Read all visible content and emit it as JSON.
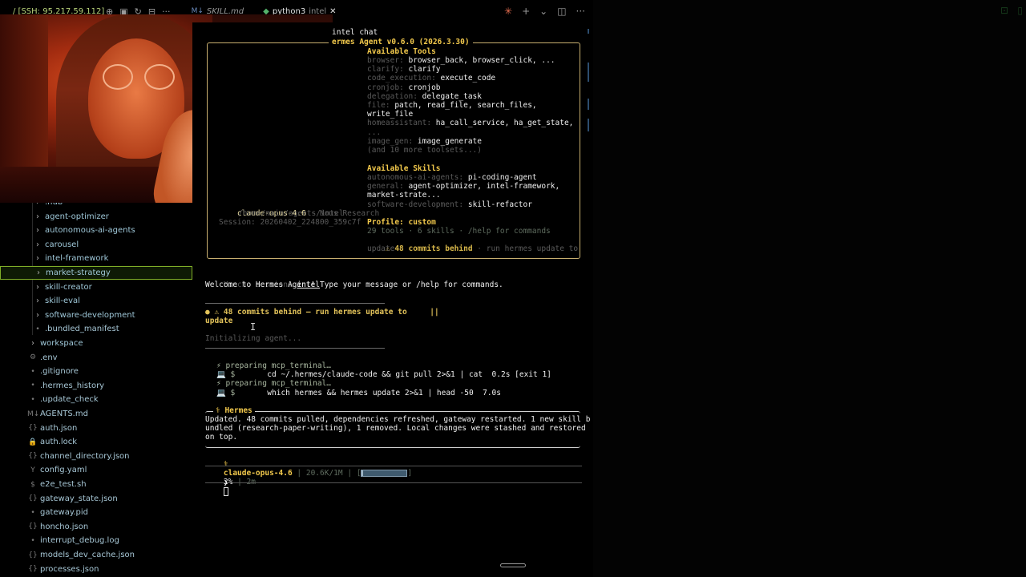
{
  "topbar": {
    "ssh_label": "/ [SSH: 95.217.59.112]",
    "tabs": [
      {
        "icon": "M↓",
        "label": "SKILL.md",
        "active": false
      },
      {
        "icon": "python-icon",
        "label": "python3",
        "sublabel": "intel",
        "active": true
      }
    ],
    "close_symbol": "✕",
    "more_symbol": "···"
  },
  "sidebar": {
    "items": [
      {
        "label": ".hub",
        "type": "folder",
        "indent": 1
      },
      {
        "label": "agent-optimizer",
        "type": "folder",
        "indent": 1
      },
      {
        "label": "autonomous-ai-agents",
        "type": "folder",
        "indent": 1
      },
      {
        "label": "carousel",
        "type": "folder",
        "indent": 1
      },
      {
        "label": "intel-framework",
        "type": "folder",
        "indent": 1
      },
      {
        "label": "market-strategy",
        "type": "folder",
        "indent": 1,
        "selected": true
      },
      {
        "label": "skill-creator",
        "type": "folder",
        "indent": 1
      },
      {
        "label": "skill-eval",
        "type": "folder",
        "indent": 1
      },
      {
        "label": "software-development",
        "type": "folder",
        "indent": 1
      },
      {
        "label": ".bundled_manifest",
        "type": "file",
        "indent": 1
      },
      {
        "label": "workspace",
        "type": "folder",
        "indent": 0
      },
      {
        "label": ".env",
        "type": "file",
        "indent": 0
      },
      {
        "label": ".gitignore",
        "type": "file",
        "indent": 0
      },
      {
        "label": ".hermes_history",
        "type": "file",
        "indent": 0
      },
      {
        "label": ".update_check",
        "type": "file",
        "indent": 0
      },
      {
        "label": "AGENTS.md",
        "type": "file",
        "indent": 0
      },
      {
        "label": "auth.json",
        "type": "file",
        "indent": 0
      },
      {
        "label": "auth.lock",
        "type": "file",
        "indent": 0
      },
      {
        "label": "channel_directory.json",
        "type": "file",
        "indent": 0
      },
      {
        "label": "config.yaml",
        "type": "file",
        "indent": 0
      },
      {
        "label": "e2e_test.sh",
        "type": "file",
        "indent": 0
      },
      {
        "label": "gateway_state.json",
        "type": "file",
        "indent": 0
      },
      {
        "label": "gateway.pid",
        "type": "file",
        "indent": 0
      },
      {
        "label": "honcho.json",
        "type": "file",
        "indent": 0
      },
      {
        "label": "interrupt_debug.log",
        "type": "file",
        "indent": 0
      },
      {
        "label": "models_dev_cache.json",
        "type": "file",
        "indent": 0
      },
      {
        "label": "processes.json",
        "type": "file",
        "indent": 0
      }
    ]
  },
  "terminal": {
    "chat_cmd": "intel chat",
    "banner_title": "ermes Agent v0.6.0 (2026.3.30)",
    "tools_heading": "Available Tools",
    "tools": [
      {
        "k": "browser: ",
        "v": "browser_back, browser_click, ..."
      },
      {
        "k": "clarify: ",
        "v": "clarify"
      },
      {
        "k": "code_execution: ",
        "v": "execute_code"
      },
      {
        "k": "cronjob: ",
        "v": "cronjob"
      },
      {
        "k": "delegation: ",
        "v": "delegate_task"
      },
      {
        "k": "file: ",
        "v": "patch, read_file, search_files,"
      },
      {
        "k": "",
        "v": "write_file"
      },
      {
        "k": "homeassistant: ",
        "v": "ha_call_service, ha_get_state,"
      },
      {
        "k": "...",
        "v": ""
      },
      {
        "k": "image_gen: ",
        "v": "image_generate"
      },
      {
        "k": "(and 10 more toolsets...)",
        "v": ""
      }
    ],
    "skills_heading": "Available Skills",
    "skills": [
      {
        "k": "autonomous-ai-agents: ",
        "v": "pi-coding-agent"
      },
      {
        "k": "general: ",
        "v": "agent-optimizer, intel-framework,"
      },
      {
        "k": "",
        "v": "market-strate..."
      },
      {
        "k": "software-development: ",
        "v": "skill-refactor"
      }
    ],
    "model": "claude-opus-4.6",
    "provider": " · Nous Research",
    "cwd": "/home/main/agents/intel",
    "session": "Session: 20260402_224800_359c7f",
    "profile_label": "Profile: custom",
    "summary": "29 tools · 6 skills · /help for commands",
    "commits_behind_bold": "⚠ 48 commits behind",
    "commits_behind_rest": " · run hermes update to",
    "commits_behind_rest2": "update",
    "honcho_label": "Honcho session: ",
    "honcho_value": "intel",
    "welcome": "Welcome to Hermes Agent! Type your message or /help for commands.",
    "warn_line1": "● ⚠ 48 commits behind — run hermes update to     ||",
    "warn_line2": "update",
    "initializing": "Initializing agent...",
    "steps": [
      {
        "a": "⚡ preparing mcp_terminal…",
        "b": ""
      },
      {
        "a": "💻 $",
        "b": "cd ~/.hermes/claude-code && git pull 2>&1 | cat  0.2s [exit 1]"
      },
      {
        "a": "⚡ preparing mcp_terminal…",
        "b": ""
      },
      {
        "a": "💻 $",
        "b": "which hermes && hermes update 2>&1 | head -50  7.0s"
      }
    ],
    "response_label": "⚕ Hermes",
    "response": [
      "Updated. 48 commits pulled, dependencies refreshed, gateway restarted. 1 new skill b",
      "undled (research-paper-writing), 1 removed. Local changes were stashed and restored",
      "on top."
    ],
    "status": {
      "icon": "⚕",
      "model": "claude-opus-4.6",
      "tokens": " | 20.6K/1M | [",
      "progress_end": "]",
      "percent": "2%",
      "sep": " | ",
      "time": "2m",
      "context_used": 0.02
    },
    "prompt_symbol": "❯"
  }
}
